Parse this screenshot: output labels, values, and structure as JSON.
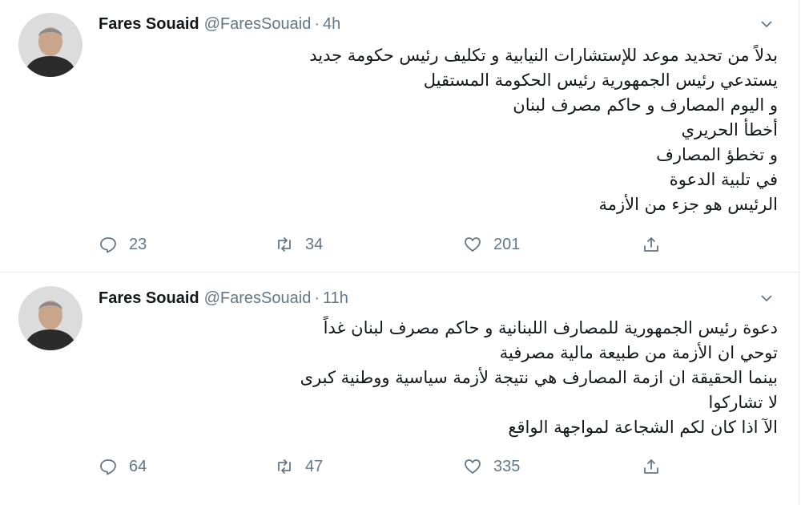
{
  "tweets": [
    {
      "author_name": "Fares Souaid",
      "handle": "@FaresSouaid",
      "separator": "·",
      "time": "4h",
      "lines": [
        "بدلاً من تحديد موعد للإستشارات النيابية و تكليف رئيس حكومة جديد",
        "يستدعي رئيس الجمهورية رئيس الحكومة المستقيل",
        "و اليوم المصارف و حاكم مصرف لبنان",
        "أخطأ الحريري",
        "و تخطؤ المصارف",
        "في تلبية الدعوة",
        "الرئيس هو جزء من الأزمة"
      ],
      "replies": "23",
      "retweets": "34",
      "likes": "201"
    },
    {
      "author_name": "Fares Souaid",
      "handle": "@FaresSouaid",
      "separator": "·",
      "time": "11h",
      "lines": [
        "دعوة رئيس الجمهورية للمصارف اللبنانية و حاكم مصرف لبنان غداً",
        "توحي ان الأزمة من طبيعة مالية مصرفية",
        "بينما الحقيقة ان ازمة المصارف هي نتيجة لأزمة سياسية ووطنية كبرى",
        "لا تشاركوا",
        "الآ اذا كان لكم الشجاعة لمواجهة الواقع"
      ],
      "replies": "64",
      "retweets": "47",
      "likes": "335"
    }
  ],
  "icons": {
    "reply": "reply-icon",
    "retweet": "retweet-icon",
    "like": "heart-icon",
    "share": "share-icon",
    "caret": "chevron-down-icon"
  },
  "colors": {
    "text": "#14171a",
    "secondary": "#657786",
    "divider": "#e6ecf0"
  }
}
